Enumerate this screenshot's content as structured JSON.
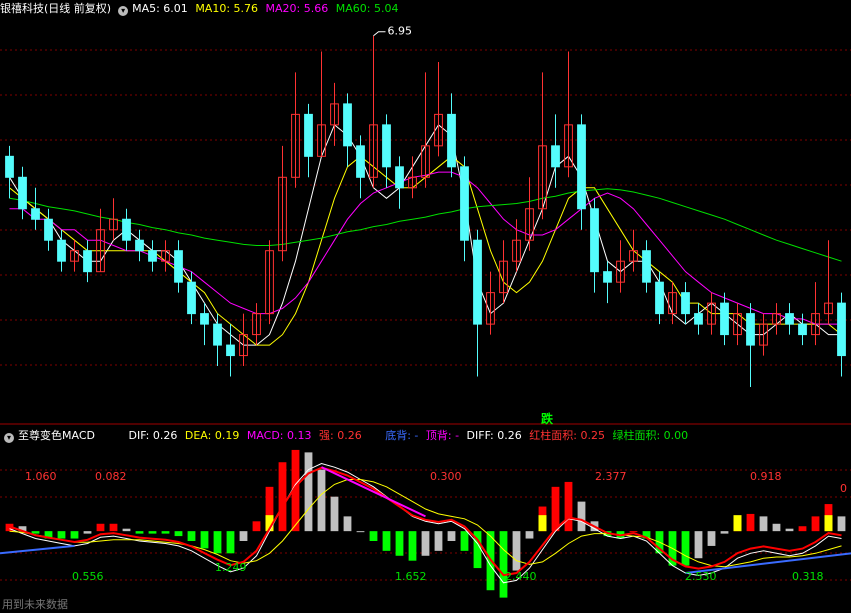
{
  "header": {
    "title": "银禧科技(日线 前复权)",
    "ma5": "MA5: 6.01",
    "ma10": "MA10: 5.76",
    "ma20": "MA20: 5.66",
    "ma60": "MA60: 5.04",
    "high_label": "6.95",
    "signal_label": "跌"
  },
  "macd_header": {
    "name": "至尊变色MACD",
    "dif": "DIF: 0.26",
    "dea": "DEA: 0.19",
    "macd": "MACD: 0.13",
    "strong": "强: 0.26",
    "bottom_div": "底背: -",
    "top_div": "顶背: -",
    "diff": "DIFF: 0.26",
    "red_area": "红柱面积: 0.25",
    "green_area": "绿柱面积: 0.00"
  },
  "footer": {
    "text": "用到未来数据"
  },
  "colors": {
    "up": "#ff3232",
    "down": "#54fcfc",
    "ma5": "#ffffff",
    "ma10": "#ffff00",
    "ma20": "#ff00ff",
    "ma60": "#00e000",
    "bar_red": "#ff0000",
    "bar_green": "#00ff00",
    "bar_grey": "#c0c0c0",
    "bar_yellow": "#ffff00",
    "grid": "#800000"
  },
  "chart_data": [
    {
      "type": "candlestick",
      "title": "银禧科技(日线 前复权)",
      "ylim": [
        3.4,
        7.1
      ],
      "high_marker": 6.95,
      "series": [
        {
          "name": "MA5",
          "values": [
            5.6,
            5.4,
            5.3,
            5.2,
            5.0,
            4.9,
            4.8,
            4.8,
            5.0,
            5.1,
            5.0,
            4.9,
            4.9,
            4.8,
            4.6,
            4.4,
            4.2,
            4.1,
            4.0,
            4.0,
            4.1,
            4.4,
            4.8,
            5.3,
            5.8,
            6.1,
            6.0,
            5.8,
            5.5,
            5.4,
            5.5,
            5.7,
            5.9,
            6.1,
            6.0,
            5.4,
            4.6,
            4.3,
            4.4,
            4.7,
            5.0,
            5.3,
            5.7,
            5.8,
            5.6,
            5.2,
            4.8,
            4.7,
            4.8,
            4.8,
            4.6,
            4.3,
            4.2,
            4.3,
            4.4,
            4.3,
            4.2,
            4.1,
            4.1,
            4.2,
            4.3,
            4.2,
            4.2,
            4.1,
            4.1
          ]
        },
        {
          "name": "MA10",
          "values": [
            5.5,
            5.4,
            5.3,
            5.2,
            5.1,
            5.0,
            4.9,
            4.9,
            4.9,
            4.9,
            4.9,
            4.9,
            4.8,
            4.7,
            4.6,
            4.5,
            4.3,
            4.2,
            4.1,
            4.0,
            4.0,
            4.1,
            4.3,
            4.6,
            5.0,
            5.4,
            5.7,
            5.8,
            5.7,
            5.6,
            5.5,
            5.5,
            5.6,
            5.7,
            5.8,
            5.7,
            5.3,
            4.9,
            4.6,
            4.5,
            4.6,
            4.8,
            5.1,
            5.4,
            5.5,
            5.5,
            5.3,
            5.1,
            4.9,
            4.8,
            4.7,
            4.6,
            4.4,
            4.4,
            4.3,
            4.3,
            4.3,
            4.2,
            4.2,
            4.2,
            4.2,
            4.2,
            4.2,
            4.2,
            4.1
          ]
        },
        {
          "name": "MA20",
          "values": [
            5.3,
            5.3,
            5.2,
            5.2,
            5.1,
            5.1,
            5.0,
            5.0,
            4.95,
            4.9,
            4.9,
            4.85,
            4.8,
            4.75,
            4.7,
            4.6,
            4.5,
            4.4,
            4.35,
            4.3,
            4.3,
            4.35,
            4.45,
            4.6,
            4.8,
            5.0,
            5.2,
            5.35,
            5.45,
            5.5,
            5.55,
            5.6,
            5.62,
            5.65,
            5.65,
            5.6,
            5.5,
            5.35,
            5.2,
            5.1,
            5.05,
            5.05,
            5.1,
            5.2,
            5.3,
            5.4,
            5.45,
            5.4,
            5.3,
            5.15,
            5.0,
            4.85,
            4.7,
            4.6,
            4.5,
            4.45,
            4.4,
            4.35,
            4.3,
            4.3,
            4.25,
            4.25,
            4.2,
            4.2,
            4.2
          ]
        },
        {
          "name": "MA60",
          "values": [
            5.4,
            5.38,
            5.35,
            5.32,
            5.3,
            5.28,
            5.25,
            5.22,
            5.2,
            5.17,
            5.15,
            5.12,
            5.1,
            5.07,
            5.05,
            5.02,
            5.0,
            4.98,
            4.96,
            4.95,
            4.95,
            4.96,
            4.98,
            5.0,
            5.02,
            5.05,
            5.08,
            5.1,
            5.13,
            5.15,
            5.18,
            5.2,
            5.22,
            5.25,
            5.27,
            5.3,
            5.32,
            5.33,
            5.34,
            5.35,
            5.37,
            5.4,
            5.42,
            5.45,
            5.47,
            5.48,
            5.49,
            5.48,
            5.46,
            5.43,
            5.4,
            5.36,
            5.32,
            5.28,
            5.24,
            5.2,
            5.15,
            5.1,
            5.05,
            5.0,
            4.96,
            4.92,
            4.88,
            4.84,
            4.8
          ]
        }
      ],
      "candles": [
        [
          5.8,
          5.6,
          5.9,
          5.4
        ],
        [
          5.6,
          5.3,
          5.7,
          5.2
        ],
        [
          5.3,
          5.2,
          5.5,
          5.1
        ],
        [
          5.2,
          5.0,
          5.3,
          4.9
        ],
        [
          5.0,
          4.8,
          5.1,
          4.7
        ],
        [
          4.8,
          4.9,
          5.0,
          4.7
        ],
        [
          4.9,
          4.7,
          5.0,
          4.6
        ],
        [
          4.7,
          5.1,
          5.3,
          4.7
        ],
        [
          5.1,
          5.2,
          5.4,
          5.0
        ],
        [
          5.2,
          5.0,
          5.3,
          4.9
        ],
        [
          5.0,
          4.9,
          5.1,
          4.8
        ],
        [
          4.9,
          4.8,
          5.0,
          4.7
        ],
        [
          4.8,
          4.9,
          5.0,
          4.7
        ],
        [
          4.9,
          4.6,
          5.0,
          4.5
        ],
        [
          4.6,
          4.3,
          4.7,
          4.2
        ],
        [
          4.3,
          4.2,
          4.4,
          4.0
        ],
        [
          4.2,
          4.0,
          4.3,
          3.8
        ],
        [
          4.0,
          3.9,
          4.2,
          3.7
        ],
        [
          3.9,
          4.1,
          4.3,
          3.8
        ],
        [
          4.1,
          4.3,
          4.4,
          4.0
        ],
        [
          4.3,
          4.9,
          5.0,
          4.2
        ],
        [
          4.9,
          5.6,
          5.9,
          4.8
        ],
        [
          5.6,
          6.2,
          6.6,
          5.5
        ],
        [
          6.2,
          5.8,
          6.3,
          5.6
        ],
        [
          5.8,
          6.1,
          6.8,
          5.8
        ],
        [
          6.1,
          6.3,
          6.5,
          5.9
        ],
        [
          6.3,
          5.9,
          6.4,
          5.7
        ],
        [
          5.9,
          5.6,
          6.0,
          5.4
        ],
        [
          5.6,
          6.1,
          6.95,
          5.5
        ],
        [
          6.1,
          5.7,
          6.2,
          5.5
        ],
        [
          5.7,
          5.5,
          5.8,
          5.3
        ],
        [
          5.5,
          5.6,
          5.8,
          5.4
        ],
        [
          5.6,
          5.9,
          6.6,
          5.5
        ],
        [
          5.9,
          6.2,
          6.7,
          5.8
        ],
        [
          6.2,
          5.7,
          6.4,
          5.6
        ],
        [
          5.7,
          5.0,
          5.8,
          4.8
        ],
        [
          5.0,
          4.2,
          5.1,
          3.7
        ],
        [
          4.2,
          4.5,
          4.7,
          4.1
        ],
        [
          4.5,
          4.8,
          5.0,
          4.4
        ],
        [
          4.8,
          5.0,
          5.2,
          4.7
        ],
        [
          5.0,
          5.3,
          5.6,
          4.9
        ],
        [
          5.3,
          5.9,
          6.6,
          5.2
        ],
        [
          5.9,
          5.7,
          6.2,
          5.5
        ],
        [
          5.7,
          6.1,
          6.8,
          5.6
        ],
        [
          6.1,
          5.3,
          6.2,
          5.1
        ],
        [
          5.3,
          4.7,
          5.4,
          4.5
        ],
        [
          4.7,
          4.6,
          4.8,
          4.4
        ],
        [
          4.6,
          4.8,
          5.0,
          4.5
        ],
        [
          4.8,
          4.9,
          5.1,
          4.7
        ],
        [
          4.9,
          4.6,
          5.0,
          4.5
        ],
        [
          4.6,
          4.3,
          4.7,
          4.2
        ],
        [
          4.3,
          4.5,
          4.6,
          4.2
        ],
        [
          4.5,
          4.3,
          4.6,
          4.2
        ],
        [
          4.3,
          4.2,
          4.4,
          4.1
        ],
        [
          4.2,
          4.4,
          4.5,
          4.1
        ],
        [
          4.4,
          4.1,
          4.5,
          4.0
        ],
        [
          4.1,
          4.3,
          4.4,
          4.0
        ],
        [
          4.3,
          4.0,
          4.4,
          3.6
        ],
        [
          4.0,
          4.2,
          4.3,
          3.9
        ],
        [
          4.2,
          4.3,
          4.4,
          4.1
        ],
        [
          4.3,
          4.2,
          4.4,
          4.1
        ],
        [
          4.2,
          4.1,
          4.3,
          4.0
        ],
        [
          4.1,
          4.3,
          4.6,
          4.0
        ],
        [
          4.3,
          4.4,
          5.0,
          4.2
        ],
        [
          4.4,
          3.9,
          4.5,
          3.7
        ]
      ]
    },
    {
      "type": "bar",
      "title": "至尊变色MACD",
      "ylim": [
        -0.6,
        0.7
      ],
      "labels": [
        "1.060",
        "0.082",
        "0.556",
        "1.249",
        "1.652",
        "0.300",
        "2.440",
        "2.377",
        "2.530",
        "0.918",
        "0.318",
        "0"
      ],
      "series": [
        {
          "name": "DIF",
          "values": [
            0.02,
            -0.02,
            -0.06,
            -0.08,
            -0.1,
            -0.12,
            -0.1,
            -0.05,
            -0.04,
            -0.06,
            -0.08,
            -0.09,
            -0.1,
            -0.12,
            -0.16,
            -0.22,
            -0.28,
            -0.33,
            -0.3,
            -0.2,
            0.0,
            0.2,
            0.38,
            0.5,
            0.55,
            0.52,
            0.48,
            0.42,
            0.36,
            0.28,
            0.2,
            0.12,
            0.08,
            0.06,
            0.08,
            0.02,
            -0.1,
            -0.28,
            -0.42,
            -0.4,
            -0.3,
            -0.15,
            0.0,
            0.1,
            0.08,
            0.02,
            -0.04,
            -0.06,
            -0.04,
            -0.08,
            -0.18,
            -0.28,
            -0.34,
            -0.36,
            -0.34,
            -0.3,
            -0.22,
            -0.18,
            -0.16,
            -0.18,
            -0.2,
            -0.18,
            -0.12,
            -0.04,
            -0.06
          ]
        },
        {
          "name": "DEA",
          "values": [
            0.0,
            -0.01,
            -0.03,
            -0.05,
            -0.07,
            -0.09,
            -0.09,
            -0.08,
            -0.07,
            -0.07,
            -0.07,
            -0.08,
            -0.09,
            -0.1,
            -0.12,
            -0.15,
            -0.19,
            -0.24,
            -0.26,
            -0.24,
            -0.18,
            -0.08,
            0.05,
            0.18,
            0.3,
            0.38,
            0.42,
            0.42,
            0.4,
            0.36,
            0.3,
            0.24,
            0.18,
            0.14,
            0.12,
            0.1,
            0.05,
            -0.04,
            -0.15,
            -0.24,
            -0.27,
            -0.25,
            -0.18,
            -0.1,
            -0.04,
            -0.02,
            -0.02,
            -0.03,
            -0.04,
            -0.05,
            -0.09,
            -0.14,
            -0.2,
            -0.25,
            -0.28,
            -0.29,
            -0.27,
            -0.25,
            -0.22,
            -0.21,
            -0.21,
            -0.2,
            -0.18,
            -0.15,
            -0.12
          ]
        },
        {
          "name": "MACD",
          "values": [
            0.06,
            0.04,
            -0.02,
            -0.06,
            -0.06,
            -0.06,
            -0.02,
            0.06,
            0.06,
            0.02,
            -0.02,
            -0.02,
            -0.02,
            -0.04,
            -0.08,
            -0.14,
            -0.18,
            -0.18,
            -0.08,
            0.08,
            0.36,
            0.56,
            0.66,
            0.64,
            0.5,
            0.28,
            0.12,
            0.0,
            -0.08,
            -0.16,
            -0.2,
            -0.24,
            -0.2,
            -0.16,
            -0.08,
            -0.16,
            -0.3,
            -0.48,
            -0.54,
            -0.32,
            -0.06,
            0.2,
            0.36,
            0.4,
            0.24,
            0.08,
            -0.04,
            -0.06,
            0.0,
            -0.06,
            -0.18,
            -0.28,
            -0.28,
            -0.22,
            -0.12,
            -0.02,
            0.1,
            0.14,
            0.12,
            0.06,
            0.02,
            0.04,
            0.12,
            0.22,
            0.12
          ]
        }
      ]
    }
  ]
}
